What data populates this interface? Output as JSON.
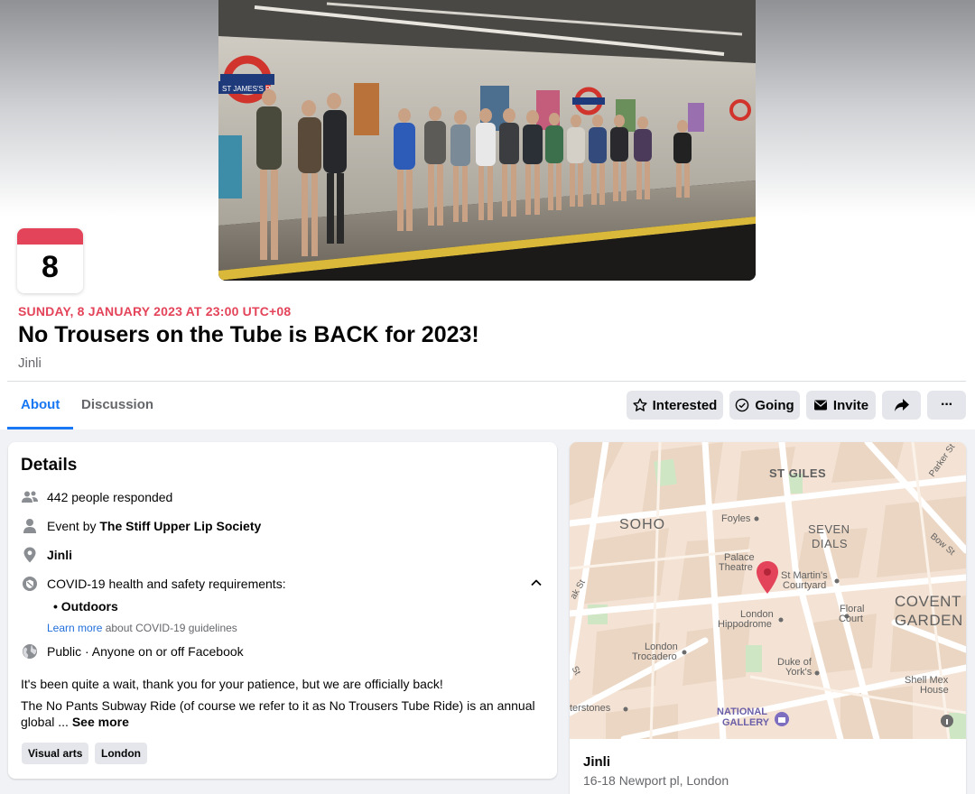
{
  "event": {
    "day": "8",
    "date_line": "SUNDAY, 8 JANUARY 2023 AT 23:00 UTC+08",
    "title": "No Trousers on the Tube is BACK for 2023!",
    "host": "Jinli",
    "cover_station_sign": "ST JAMES'S P"
  },
  "tabs": [
    {
      "label": "About",
      "active": true
    },
    {
      "label": "Discussion",
      "active": false
    }
  ],
  "actions": {
    "interested": "Interested",
    "going": "Going",
    "invite": "Invite",
    "share_icon": "share-icon",
    "more_icon": "more-icon",
    "more_label": "···"
  },
  "details": {
    "heading": "Details",
    "responded": "442 people responded",
    "event_by_prefix": "Event by ",
    "event_by_name": "The Stiff Upper Lip Society",
    "location": "Jinli",
    "covid_heading": "COVID-19 health and safety requirements:",
    "covid_items": [
      "Outdoors"
    ],
    "learn_more_link": "Learn more",
    "learn_more_rest": " about COVID-19 guidelines",
    "privacy": "Public · Anyone on or off Facebook",
    "description_1": "It's been quite a wait, thank you for your patience, but we are officially back!",
    "description_2": "The No Pants Subway Ride (of course we refer to it as No Trousers Tube Ride) is an annual global ... ",
    "see_more": "See more",
    "tags": [
      "Visual arts",
      "London"
    ]
  },
  "map": {
    "labels": {
      "st_giles": "ST GILES",
      "soho": "SOHO",
      "foyles": "Foyles",
      "seven": "SEVEN",
      "dials": "DIALS",
      "palace": "Palace",
      "theatre": "Theatre",
      "st_martins": "St Martin's",
      "courtyard": "Courtyard",
      "floral": "Floral",
      "court": "Court",
      "covent": "COVENT",
      "garden": "GARDEN",
      "london_hip": "London",
      "hippodrome": "Hippodrome",
      "london_tro": "London",
      "trocadero": "Trocadero",
      "duke": "Duke of",
      "yorks": "York's",
      "shell": "Shell Mex",
      "house": "House",
      "national": "NATIONAL",
      "gallery": "GALLERY",
      "parker": "Parker St",
      "bow": "Bow St",
      "sterstones": "terstones",
      "ak_st": "ak St",
      "st": "St"
    },
    "pin_color": "#e4445a"
  },
  "venue": {
    "name": "Jinli",
    "address": "16-18 Newport pl, London"
  },
  "colors": {
    "accent": "#1877f2",
    "date_red": "#e4445a"
  }
}
